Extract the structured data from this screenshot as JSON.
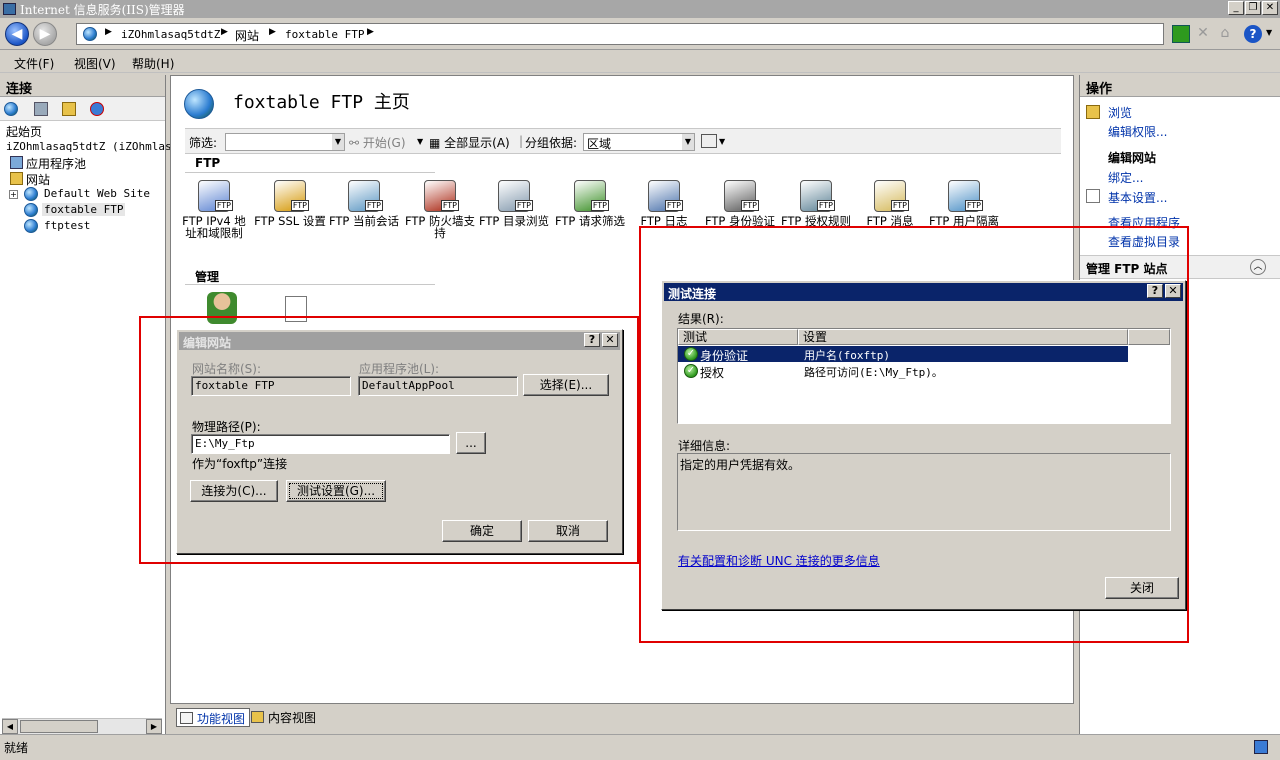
{
  "window": {
    "title": "Internet 信息服务(IIS)管理器"
  },
  "address": {
    "crumbs": [
      "iZOhmlasaq5tdtZ",
      "网站",
      "foxtable FTP"
    ]
  },
  "menu": [
    "文件(F)",
    "视图(V)",
    "帮助(H)"
  ],
  "connections": {
    "header": "连接",
    "start_page": "起始页",
    "server": "iZOhmlasaq5tdtZ (iZOhmlasa",
    "app_pools": "应用程序池",
    "sites": "网站",
    "site_items": [
      "Default Web Site",
      "foxtable FTP",
      "ftptest"
    ]
  },
  "home": {
    "title": "foxtable FTP 主页",
    "filter_label": "筛选:",
    "start_btn": "开始(G)",
    "show_all": "全部显示(A)",
    "group_label": "分组依据:",
    "group_value": "区域",
    "ftp_section": "FTP",
    "mgmt_section": "管理",
    "features": [
      {
        "label": "FTP IPv4 地址和域限制",
        "icon": "ip-restrictions-icon"
      },
      {
        "label": "FTP SSL 设置",
        "icon": "lock-icon"
      },
      {
        "label": "FTP 当前会话",
        "icon": "sessions-icon"
      },
      {
        "label": "FTP 防火墙支持",
        "icon": "firewall-icon"
      },
      {
        "label": "FTP 目录浏览",
        "icon": "directory-browsing-icon"
      },
      {
        "label": "FTP 请求筛选",
        "icon": "request-filtering-icon"
      },
      {
        "label": "FTP 日志",
        "icon": "logging-icon"
      },
      {
        "label": "FTP 身份验证",
        "icon": "authentication-icon"
      },
      {
        "label": "FTP 授权规则",
        "icon": "authorization-icon"
      },
      {
        "label": "FTP 消息",
        "icon": "messages-icon"
      },
      {
        "label": "FTP 用户隔离",
        "icon": "user-isolation-icon"
      }
    ],
    "view_tabs": [
      "功能视图",
      "内容视图"
    ]
  },
  "actions": {
    "header": "操作",
    "browse": "浏览",
    "edit_perms": "编辑权限...",
    "edit_site": "编辑网站",
    "bindings": "绑定...",
    "basic_settings": "基本设置...",
    "view_apps": "查看应用程序",
    "view_vdirs": "查看虚拟目录",
    "manage_ftp": "管理 FTP 站点"
  },
  "status": "就绪",
  "edit_site": {
    "title": "编辑网站",
    "site_name_label": "网站名称(S):",
    "site_name": "foxtable FTP",
    "app_pool_label": "应用程序池(L):",
    "app_pool": "DefaultAppPool",
    "select_btn": "选择(E)...",
    "path_label": "物理路径(P):",
    "path": "E:\\My_Ftp",
    "browse_btn": "...",
    "connect_as_text": "作为“foxftp”连接",
    "connect_btn": "连接为(C)...",
    "test_btn": "测试设置(G)...",
    "ok": "确定",
    "cancel": "取消"
  },
  "test_conn": {
    "title": "测试连接",
    "results_label": "结果(R):",
    "col_test": "测试",
    "col_setting": "设置",
    "rows": [
      {
        "test": "身份验证",
        "setting": "用户名(foxftp)"
      },
      {
        "test": "授权",
        "setting": "路径可访问(E:\\My_Ftp)。"
      }
    ],
    "details_label": "详细信息:",
    "details": "指定的用户凭据有效。",
    "link": "有关配置和诊断 UNC 连接的更多信息",
    "close": "关闭"
  }
}
